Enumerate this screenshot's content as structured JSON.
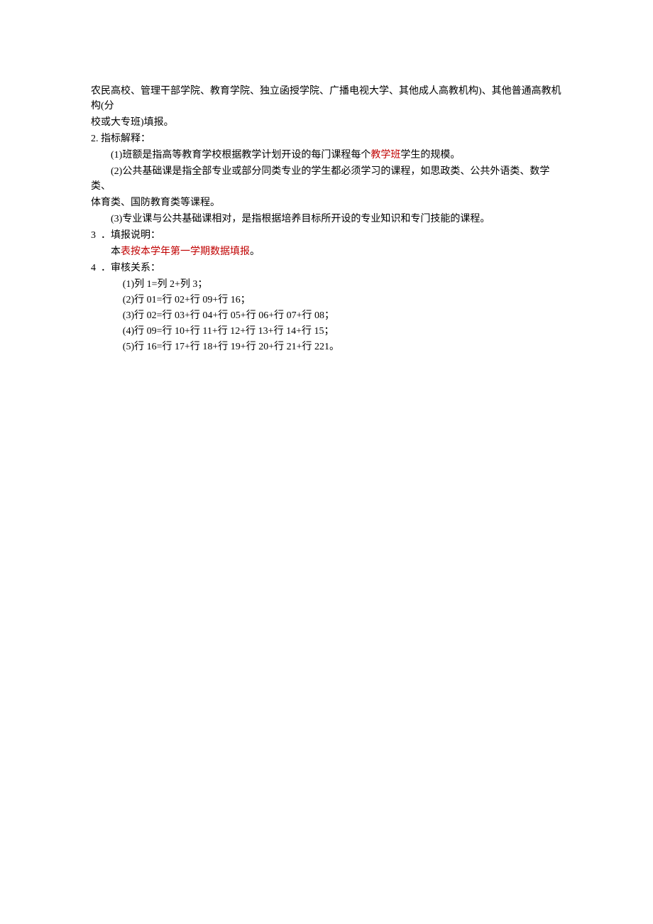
{
  "para1": {
    "line1": "农民高校、管理干部学院、教育学院、独立函授学院、广播电视大学、其他成人高教机构)、其他普通高教机构(分",
    "line2": "校或大专班)填报。"
  },
  "section2": {
    "header": "2. 指标解释：",
    "item1_pre": "(1)班额是指高等教育学校根据教学计划开设的每门课程每个",
    "item1_highlight": "教学班",
    "item1_post": "学生的规模。",
    "item2_line1": "(2)公共基础课是指全部专业或部分同类专业的学生都必须学习的课程，如思政类、公共外语类、数学类、",
    "item2_line2": "体育类、国防教育类等课程。",
    "item3": "(3)专业课与公共基础课相对，是指根据培养目标所开设的专业知识和专门技能的课程。"
  },
  "section3": {
    "num": "3",
    "header": "．填报说明：",
    "content_pre": "本",
    "content_highlight": "表按本学年第一学期数据填报",
    "content_post": "。"
  },
  "section4": {
    "num": "4",
    "header": "．审核关系：",
    "item1": "(1)列 1=列 2+列 3；",
    "item2": "(2)行 01=行 02+行 09+行 16；",
    "item3": "(3)行 02=行 03+行 04+行 05+行 06+行 07+行 08；",
    "item4": "(4)行 09=行 10+行 11+行 12+行 13+行 14+行 15；",
    "item5": "(5)行 16=行 17+行 18+行 19+行 20+行 21+行 221。"
  }
}
